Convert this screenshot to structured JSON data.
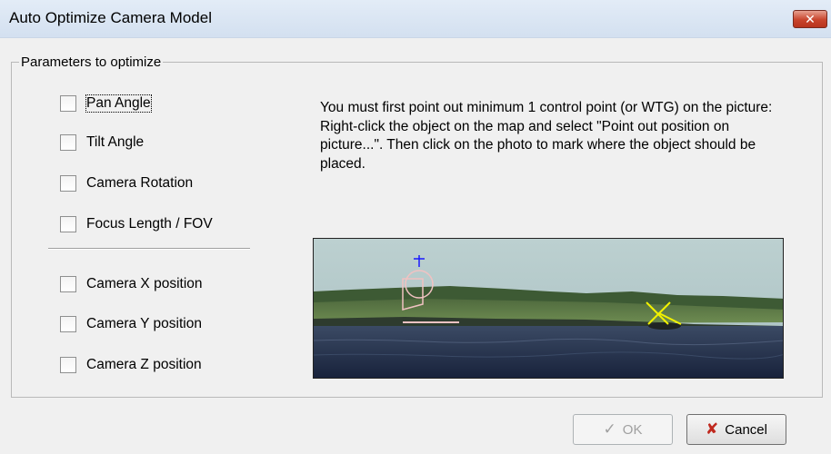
{
  "window": {
    "title": "Auto Optimize Camera Model",
    "close_glyph": "✕"
  },
  "group": {
    "legend": "Parameters to optimize",
    "checkboxes": [
      {
        "label": "Pan Angle",
        "checked": false
      },
      {
        "label": "Tilt Angle",
        "checked": false
      },
      {
        "label": "Camera Rotation",
        "checked": false
      },
      {
        "label": "Focus Length / FOV",
        "checked": false
      },
      {
        "label": "Camera X position",
        "checked": false
      },
      {
        "label": "Camera Y position",
        "checked": false
      },
      {
        "label": "Camera Z position",
        "checked": false
      }
    ],
    "instructions": "You must first point out minimum 1 control point (or WTG) on the picture: Right-click the object on the map and select \"Point out position on picture...\". Then click on the photo to mark where the object should be placed."
  },
  "buttons": {
    "ok": {
      "label": "OK",
      "icon": "check-icon",
      "enabled": false
    },
    "cancel": {
      "label": "Cancel",
      "icon": "x-icon",
      "enabled": true
    }
  },
  "colors": {
    "title_bar": "#d6e3f3",
    "close_button": "#c8442c",
    "cancel_x": "#c0281e",
    "marker_yellow": "#f2f200",
    "marker_pink": "#f1c2c2",
    "marker_blue": "#1a1aff"
  }
}
